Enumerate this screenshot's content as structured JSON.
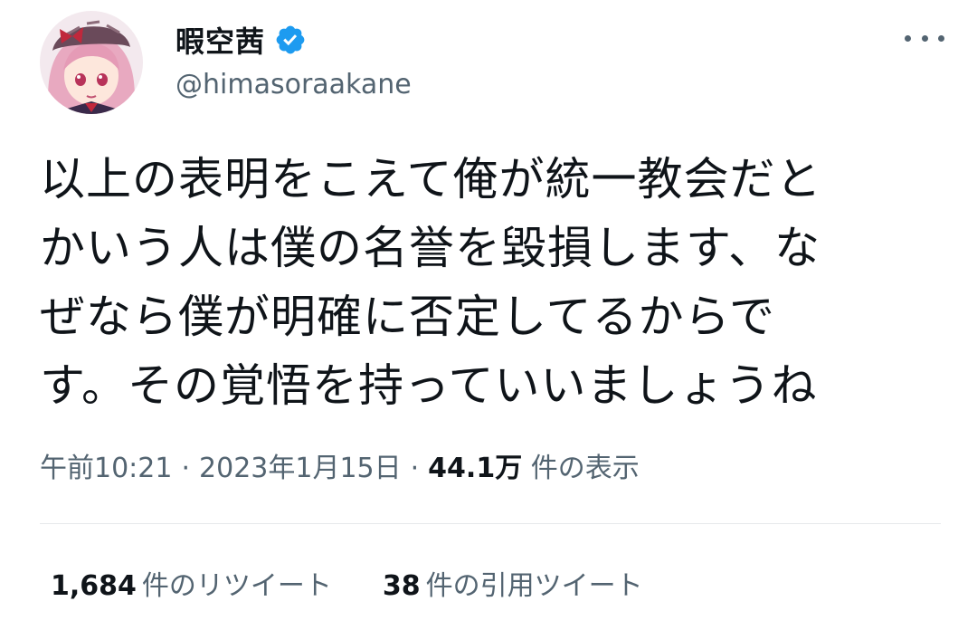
{
  "author": {
    "display_name": "暇空茜",
    "handle": "@himasoraakane",
    "verified": true
  },
  "tweet": {
    "lines": [
      "以上の表明をこえて俺が統一教会だと",
      "かいう人は僕の名誉を毀損します、な",
      "ぜなら僕が明確に否定してるからで",
      "す。その覚悟を持っていいましょうね"
    ]
  },
  "meta": {
    "time": "午前10:21",
    "date": "2023年1月15日",
    "views_count": "44.1万",
    "views_label": "件の表示"
  },
  "stats": {
    "retweets_count": "1,684",
    "retweets_label": "件のリツイート",
    "quotes_count": "38",
    "quotes_label": "件の引用ツイート"
  },
  "icons": {
    "verified": "verified-badge-icon",
    "more": "more-options-icon"
  },
  "colors": {
    "verified_blue": "#1d9bf0",
    "text_primary": "#0f1419",
    "text_secondary": "#536471"
  }
}
